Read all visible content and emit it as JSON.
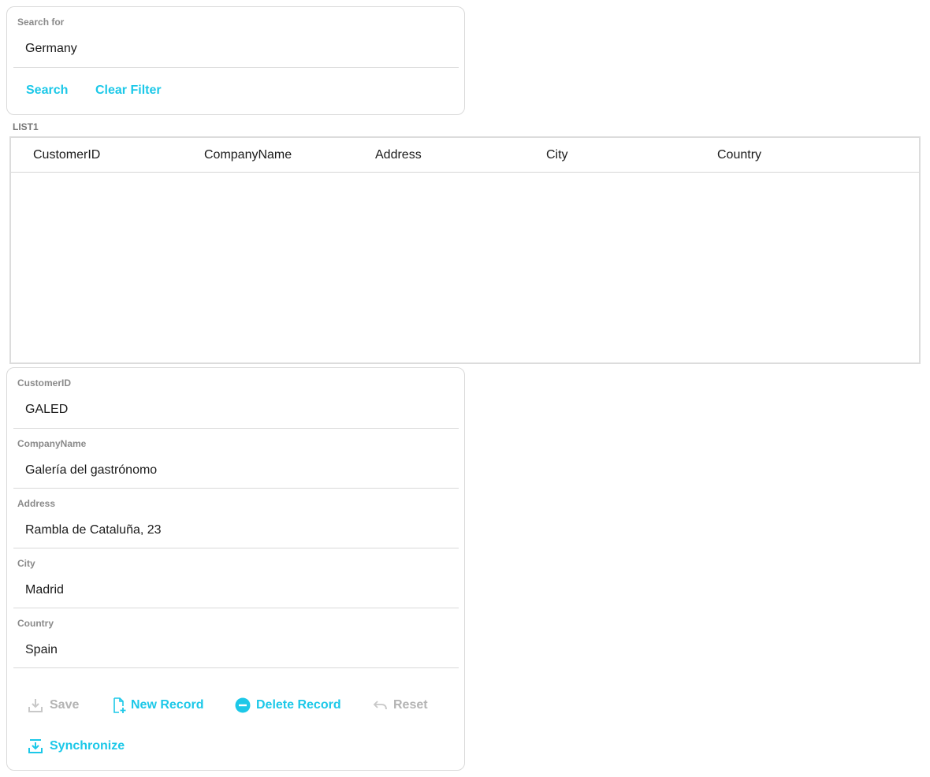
{
  "search": {
    "label": "Search for",
    "value": "Germany",
    "search_button": "Search",
    "clear_button": "Clear Filter"
  },
  "list": {
    "title": "LIST1",
    "columns": [
      "CustomerID",
      "CompanyName",
      "Address",
      "City",
      "Country"
    ],
    "rows": []
  },
  "form": {
    "fields": [
      {
        "label": "CustomerID",
        "value": "GALED"
      },
      {
        "label": "CompanyName",
        "value": "Galería del gastrónomo"
      },
      {
        "label": "Address",
        "value": "Rambla de Cataluña, 23"
      },
      {
        "label": "City",
        "value": "Madrid"
      },
      {
        "label": "Country",
        "value": "Spain"
      }
    ],
    "buttons": {
      "save": "Save",
      "new_record": "New Record",
      "delete_record": "Delete Record",
      "reset": "Reset",
      "synchronize": "Synchronize"
    }
  },
  "colors": {
    "accent": "#1cc8e8",
    "disabled": "#b3b3b3",
    "label": "#8a8a8a"
  },
  "icons": {
    "save": "save-icon",
    "new_record": "new-file-icon",
    "delete_record": "minus-circle-icon",
    "reset": "undo-icon",
    "synchronize": "download-sync-icon"
  }
}
